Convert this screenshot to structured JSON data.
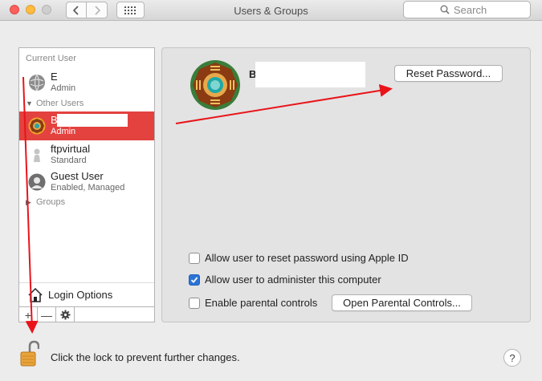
{
  "window": {
    "title": "Users & Groups",
    "search_placeholder": "Search"
  },
  "sidebar": {
    "current_user_label": "Current User",
    "current_user": {
      "name": "E",
      "role": "Admin"
    },
    "other_users_label": "Other Users",
    "users": [
      {
        "name": "B",
        "role": "Admin",
        "selected": true
      },
      {
        "name": "ftpvirtual",
        "role": "Standard",
        "selected": false
      },
      {
        "name": "Guest User",
        "role": "Enabled, Managed",
        "selected": false
      }
    ],
    "groups_label": "Groups",
    "login_options_label": "Login Options",
    "add_label": "+",
    "remove_label": "—"
  },
  "panel": {
    "user_name": "B",
    "reset_password_label": "Reset Password...",
    "options": [
      {
        "label": "Allow user to reset password using Apple ID",
        "checked": false
      },
      {
        "label": "Allow user to administer this computer",
        "checked": true
      },
      {
        "label": "Enable parental controls",
        "checked": false
      }
    ],
    "open_parental_label": "Open Parental Controls..."
  },
  "footer": {
    "lock_text": "Click the lock to prevent further changes.",
    "help_label": "?"
  },
  "colors": {
    "selection": "#e3423f",
    "annotation_arrow": "#e8141a",
    "checkbox_accent": "#2b73d6"
  }
}
